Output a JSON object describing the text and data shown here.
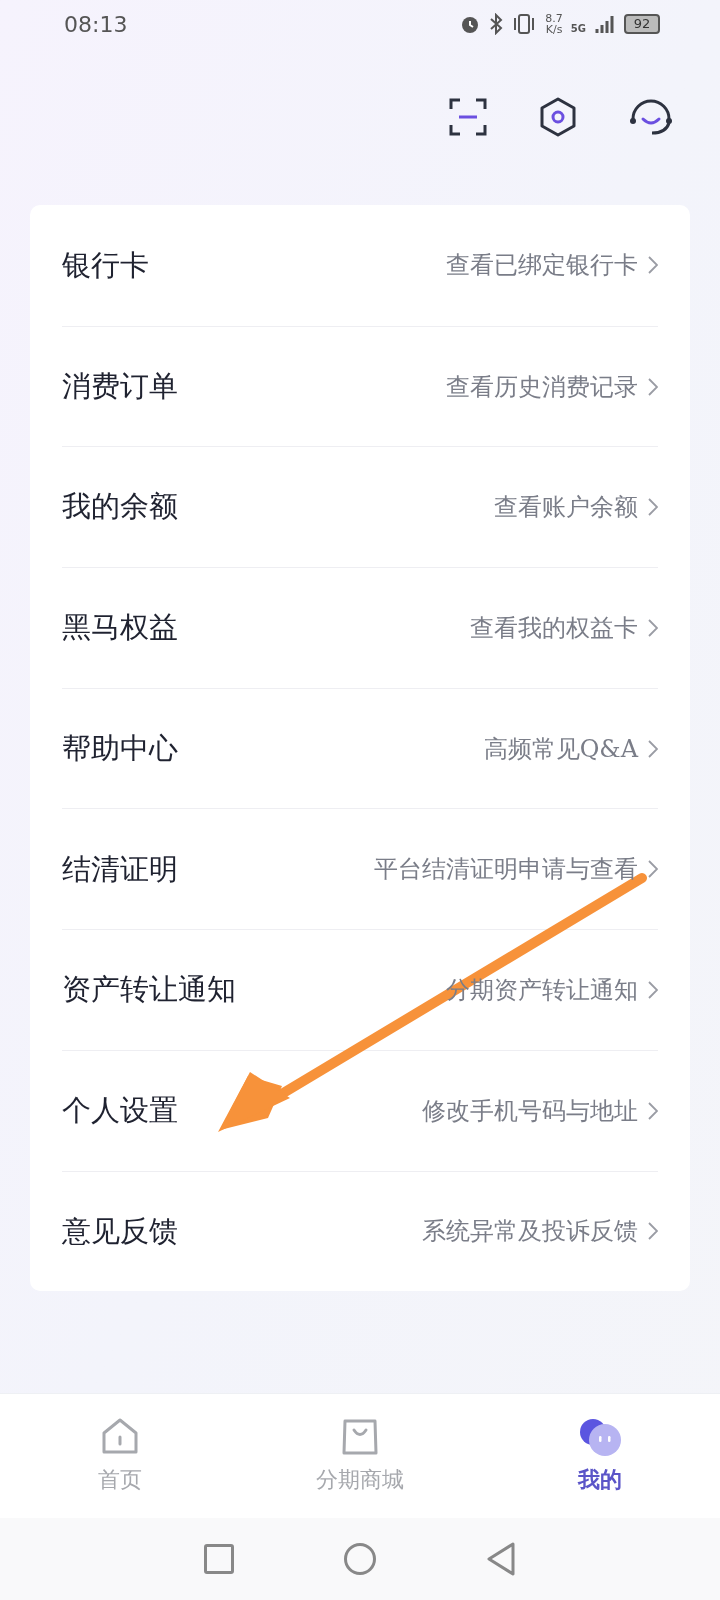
{
  "status_bar": {
    "time": "08:13",
    "speed_value": "8.7",
    "speed_unit": "K/s",
    "network": "5G",
    "battery": "92"
  },
  "menu": [
    {
      "title": "银行卡",
      "hint": "查看已绑定银行卡"
    },
    {
      "title": "消费订单",
      "hint": "查看历史消费记录"
    },
    {
      "title": "我的余额",
      "hint": "查看账户余额"
    },
    {
      "title": "黑马权益",
      "hint": "查看我的权益卡"
    },
    {
      "title": "帮助中心",
      "hint": "高频常见Q&A"
    },
    {
      "title": "结清证明",
      "hint": "平台结清证明申请与查看"
    },
    {
      "title": "资产转让通知",
      "hint": "分期资产转让通知"
    },
    {
      "title": "个人设置",
      "hint": "修改手机号码与地址"
    },
    {
      "title": "意见反馈",
      "hint": "系统异常及投诉反馈"
    }
  ],
  "tab_bar": [
    {
      "kind": "home",
      "label": "首页",
      "selected": false
    },
    {
      "kind": "shop",
      "label": "分期商城",
      "selected": false
    },
    {
      "kind": "me",
      "label": "我的",
      "selected": true
    }
  ]
}
